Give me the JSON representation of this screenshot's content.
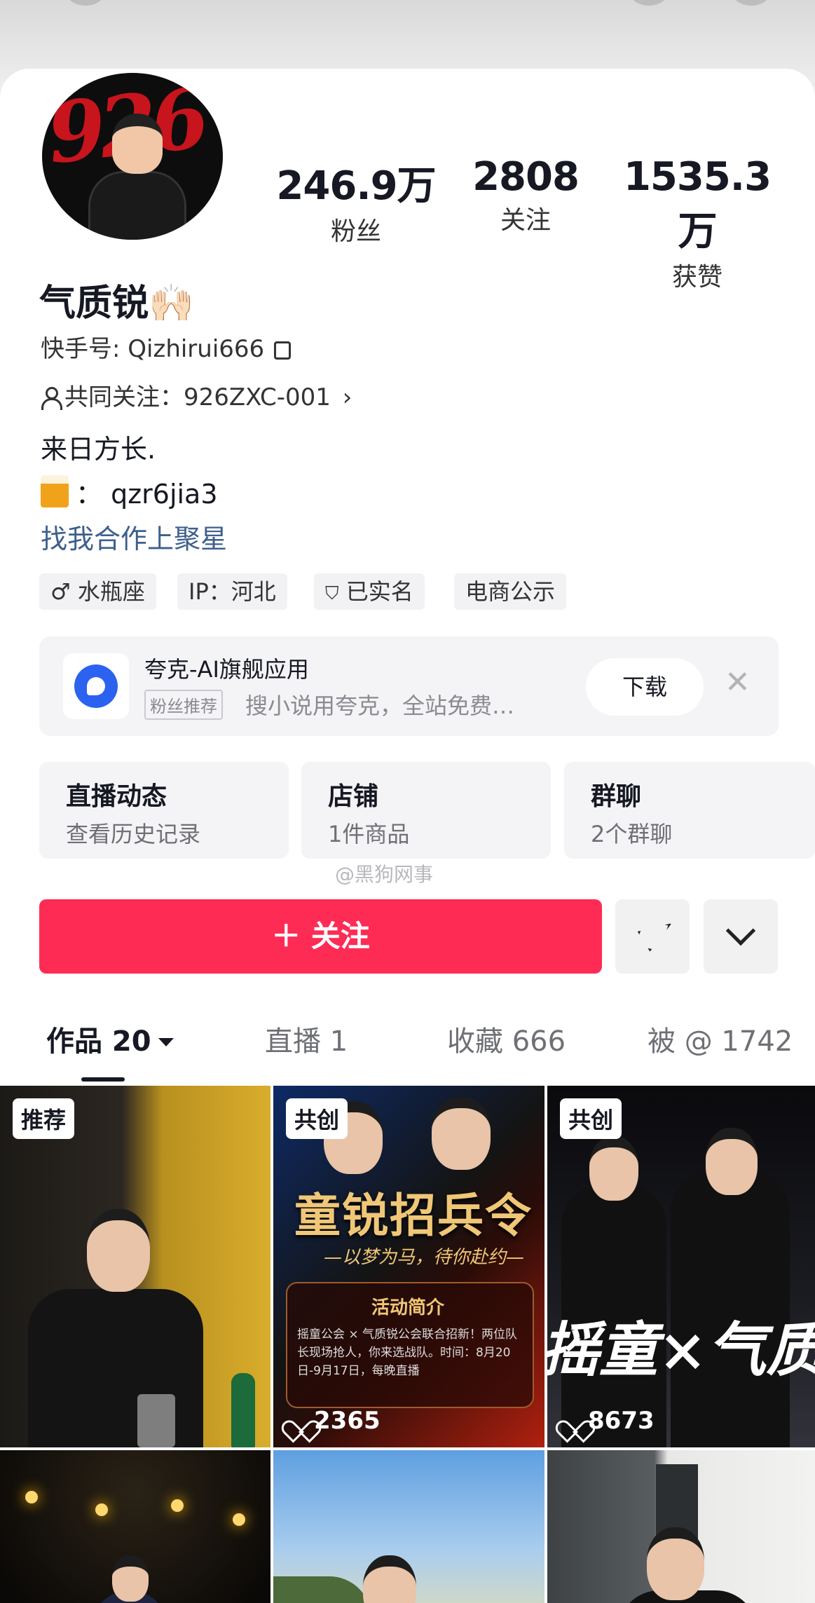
{
  "profile": {
    "avatar_text": "926",
    "name": "气质锐🙌🏻",
    "kuaishou_id": "快手号: Qizhirui666",
    "mutual_follow": "共同关注：926ZXC-001",
    "bio": "来日方长.",
    "beer_contact": "： qzr6jia3",
    "cooperation_link": "找我合作上聚星"
  },
  "stats": [
    {
      "value": "246.9万",
      "label": "粉丝"
    },
    {
      "value": "2808",
      "label": "关注"
    },
    {
      "value": "1535.3万",
      "label": "获赞"
    }
  ],
  "tags": [
    {
      "label": "♂ 水瓶座"
    },
    {
      "label": "IP：河北"
    },
    {
      "label": "已实名"
    },
    {
      "label": "电商公示"
    }
  ],
  "ad": {
    "title": "夸克-AI旗舰应用",
    "badge": "粉丝推荐",
    "description": "搜小说用夸克，全站免费…",
    "download_label": "下载",
    "close_glyph": "✕"
  },
  "features": [
    {
      "title": "直播动态",
      "subtitle": "查看历史记录"
    },
    {
      "title": "店铺",
      "subtitle": "1件商品"
    },
    {
      "title": "群聊",
      "subtitle": "2个群聊"
    }
  ],
  "watermark": "@黑狗网事",
  "actions": {
    "follow_label": "＋ 关注",
    "send_icon": "send-icon",
    "more_icon": "chevron-down-icon",
    "follow_color": "#fe2c55"
  },
  "tabs": [
    {
      "label": "作品 20",
      "active": true
    },
    {
      "label": "直播 1"
    },
    {
      "label": "收藏 666"
    },
    {
      "label": "被 @ 1742"
    }
  ],
  "works": [
    {
      "badge": "推荐",
      "likes": ""
    },
    {
      "badge": "共创",
      "likes": "2365",
      "poster_title": "童锐招兵令",
      "poster_subtitle": "—以梦为马，待你赴约—",
      "box_title": "活动简介",
      "box_text": "摇童公会 × 气质锐公会联合招新！两位队长现场抢人，你来选战队。时间：8月20日-9月17日，每晚直播"
    },
    {
      "badge": "共创",
      "likes": "8673",
      "overlay_text": "摇童×气质"
    },
    {
      "badge": "",
      "likes": ""
    },
    {
      "badge": "",
      "likes": ""
    },
    {
      "badge": "",
      "likes": ""
    }
  ]
}
